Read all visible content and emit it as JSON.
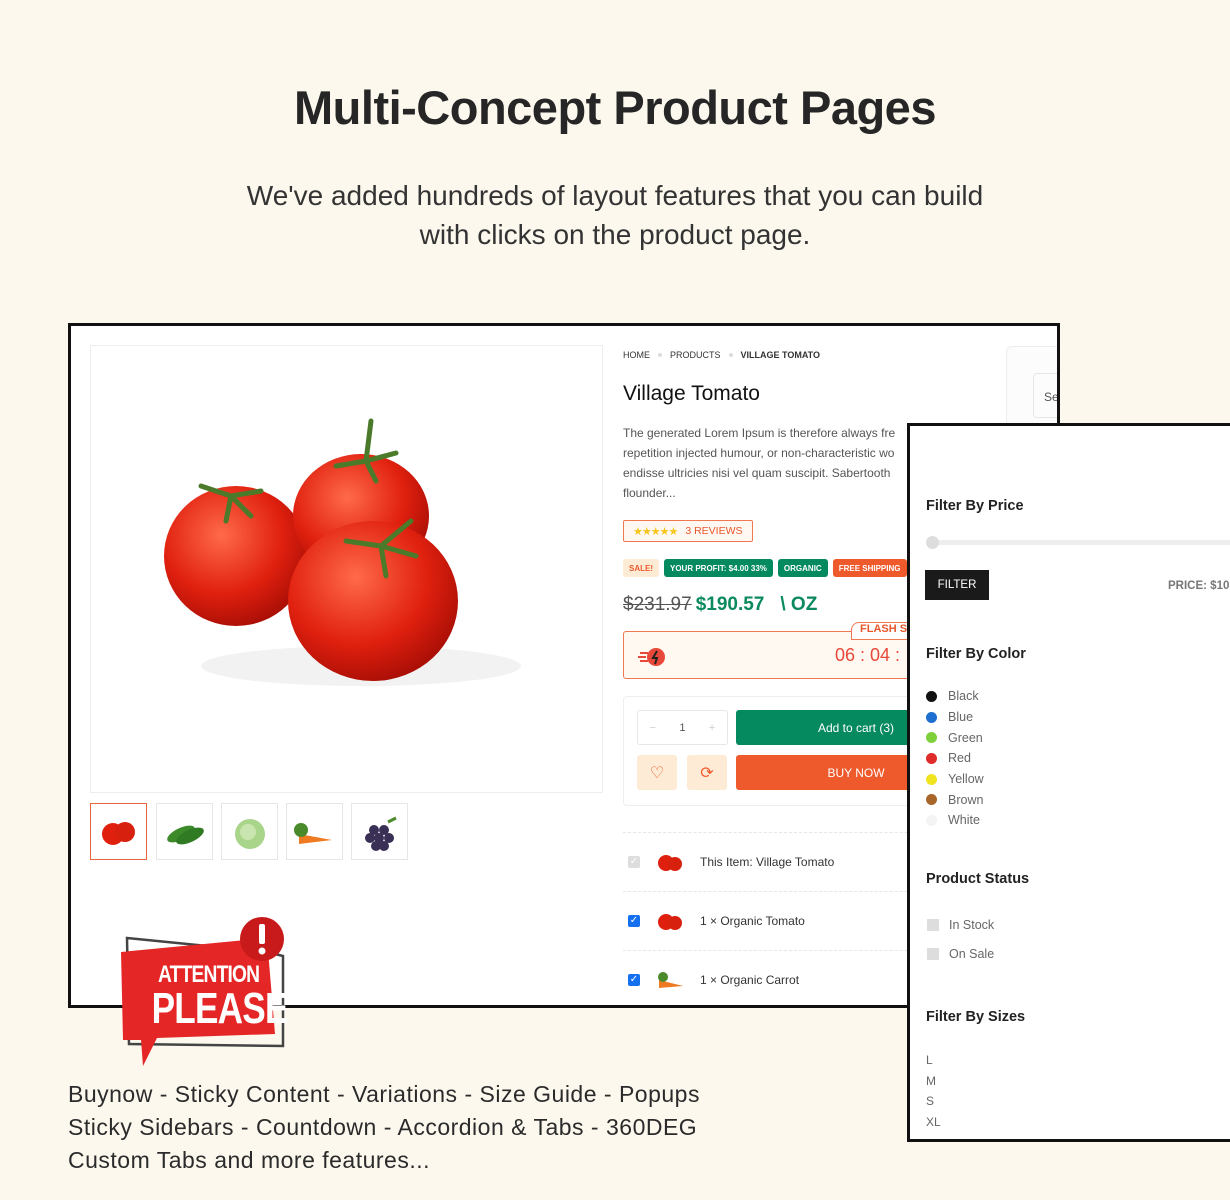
{
  "header": {
    "title": "Multi-Concept Product Pages",
    "subtitle_line1": "We've added hundreds of layout features that you can build",
    "subtitle_line2": "with clicks on the product page."
  },
  "product": {
    "breadcrumb": [
      "HOME",
      "PRODUCTS",
      "VILLAGE TOMATO"
    ],
    "title": "Village Tomato",
    "description": [
      "The generated Lorem Ipsum is therefore always fre",
      "repetition injected humour, or non-characteristic wo",
      "endisse ultricies nisi vel quam suscipit. Sabertooth",
      "flounder..."
    ],
    "rating": 4.5,
    "stars": "★★★★★",
    "reviews": "3 REVIEWS",
    "badges": [
      {
        "label": "SALE!",
        "bg": "#fdebd6",
        "color": "#ef5a2d"
      },
      {
        "label": "YOUR PROFIT: $4.00 33%",
        "bg": "#05895f",
        "color": "#ffffff"
      },
      {
        "label": "ORGANIC",
        "bg": "#05895f",
        "color": "#ffffff"
      },
      {
        "label": "FREE SHIPPING",
        "bg": "#ef5a2d",
        "color": "#ffffff"
      }
    ],
    "old_price": "$231.97",
    "price": "$190.57",
    "unit": "\\ OZ",
    "flash_label": "FLASH SA",
    "timer": "06 : 04 :",
    "quantity": "1",
    "qty_minus": "−",
    "qty_plus": "+",
    "add_to_cart": "Add to cart (3)",
    "buy_now": "BUY NOW",
    "wishlist_icon": "♡",
    "compare_icon": "⟳",
    "bundle": [
      {
        "label": "This Item: Village Tomato",
        "checked": true,
        "disabled": true
      },
      {
        "label": "1 × Organic Tomato",
        "checked": true
      },
      {
        "label": "1 × Organic Carrot",
        "checked": true
      }
    ],
    "search_partial": "Se",
    "thumbnails": [
      "tomato",
      "cucumber",
      "cabbage",
      "carrot",
      "grapes"
    ]
  },
  "colors": {
    "accent_green": "#05895f",
    "accent_orange": "#ef5a2d"
  },
  "filters": {
    "price_title": "Filter By Price",
    "filter_button": "FILTER",
    "price_label": "PRICE: $10",
    "color_title": "Filter By Color",
    "colors": [
      {
        "name": "Black",
        "hex": "#111111"
      },
      {
        "name": "Blue",
        "hex": "#1e6fd0"
      },
      {
        "name": "Green",
        "hex": "#7ed03b"
      },
      {
        "name": "Red",
        "hex": "#e02b2b"
      },
      {
        "name": "Yellow",
        "hex": "#f0e421"
      },
      {
        "name": "Brown",
        "hex": "#a8662a"
      },
      {
        "name": "White",
        "hex": "#f3f3f3"
      }
    ],
    "status_title": "Product Status",
    "status": [
      "In Stock",
      "On Sale"
    ],
    "sizes_title": "Filter By Sizes",
    "sizes": [
      "L",
      "M",
      "S",
      "XL"
    ]
  },
  "badge_art": {
    "line1": "ATTENTION",
    "line2": "PLEASE"
  },
  "features": [
    "Buynow - Sticky Content - Variations - Size Guide - Popups",
    "Sticky Sidebars - Countdown - Accordion & Tabs - 360DEG",
    "Custom Tabs and more features..."
  ]
}
